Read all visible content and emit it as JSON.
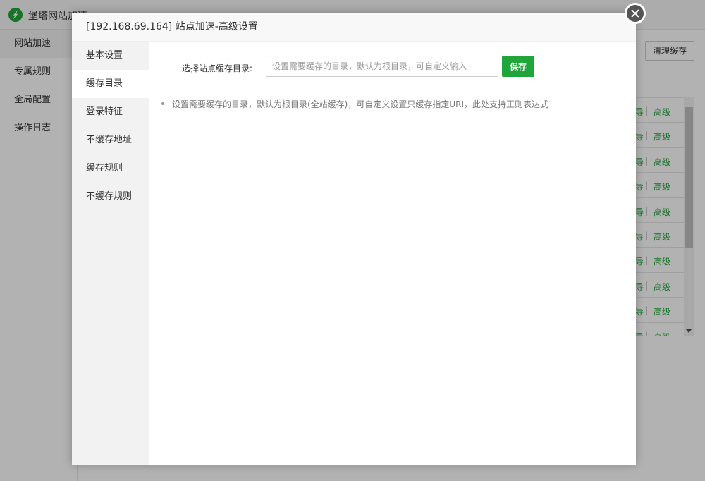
{
  "app": {
    "title": "堡塔网站加速",
    "sidebar": [
      {
        "label": "网站加速",
        "active": true
      },
      {
        "label": "专属规则",
        "active": false
      },
      {
        "label": "全局配置",
        "active": false
      },
      {
        "label": "操作日志",
        "active": false
      }
    ],
    "clear_cache_label": "清理缓存",
    "row_cells": {
      "left": "导",
      "sep": "|",
      "right": "高级"
    }
  },
  "modal": {
    "title": "[192.168.69.164] 站点加速-高级设置",
    "nav": [
      {
        "label": "基本设置",
        "active": false
      },
      {
        "label": "缓存目录",
        "active": true
      },
      {
        "label": "登录特征",
        "active": false
      },
      {
        "label": "不缓存地址",
        "active": false
      },
      {
        "label": "缓存规则",
        "active": false
      },
      {
        "label": "不缓存规则",
        "active": false
      }
    ],
    "form": {
      "label": "选择站点缓存目录:",
      "input_value": "",
      "input_placeholder": "设置需要缓存的目录，默认为根目录，可自定义输入",
      "save_label": "保存"
    },
    "help": [
      "设置需要缓存的目录，默认为根目录(全站缓存)，可自定义设置只缓存指定URI，此处支持正则表达式"
    ]
  },
  "colors": {
    "accent": "#20a53a",
    "overlay": "rgba(0,0,0,0.3)"
  }
}
